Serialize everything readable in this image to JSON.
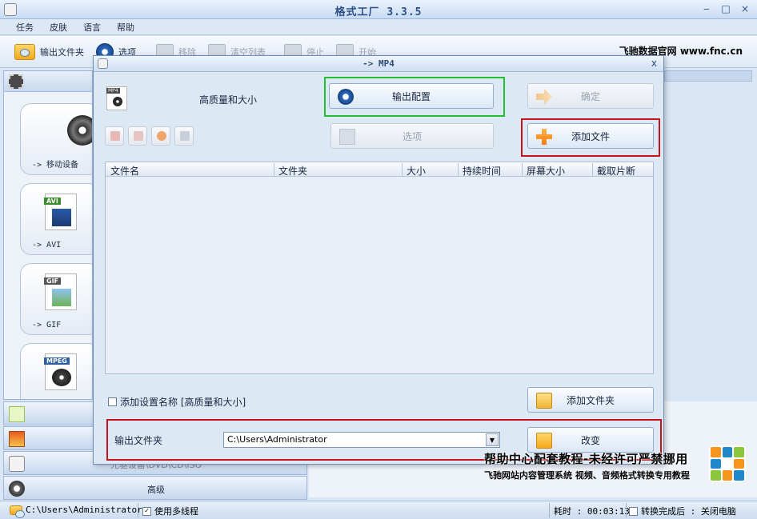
{
  "window": {
    "title": "格式工厂 3.3.5",
    "minimize": "‒",
    "maximize": "□",
    "close": "×"
  },
  "menu": [
    "任务",
    "皮肤",
    "语言",
    "帮助"
  ],
  "toolbar": {
    "output_folder": "输出文件夹",
    "options": "选项",
    "remove": "移除",
    "clear_list": "清空列表",
    "stop": "停止",
    "start": "开始"
  },
  "watermark_top": "飞驰数据官网 www.fnc.cn",
  "sidebar": {
    "tiles": [
      {
        "label": "-> 移动设备"
      },
      {
        "label": "-> AVI",
        "tag": "AVI"
      },
      {
        "label": "-> GIF",
        "tag": "GIF"
      },
      {
        "tag": "MPEG"
      }
    ],
    "behind_text": "光驱设备\\DVD\\CD\\ISO",
    "advanced": "高级"
  },
  "dialog": {
    "title": "-> MP4",
    "close": "x",
    "quality": "高质量和大小",
    "output_config_button": "输出配置",
    "ok_button": "确定",
    "options_button": "选项",
    "add_file_button": "添加文件",
    "columns": [
      "文件名",
      "文件夹",
      "大小",
      "持续时间",
      "屏幕大小",
      "截取片断"
    ],
    "add_setting_name": "添加设置名称 [高质量和大小]",
    "add_folder_button": "添加文件夹",
    "output_folder_label": "输出文件夹",
    "output_folder_value": "C:\\Users\\Administrator",
    "change_button": "改变"
  },
  "statusbar": {
    "path": "C:\\Users\\Administrator",
    "multithread": "使用多线程",
    "elapsed": "耗时 : 00:03:13",
    "after_done": "转换完成后 : 关闭电脑"
  },
  "watermark_bottom": {
    "line1": "帮助中心配套教程-未经许可严禁挪用",
    "line2": "飞驰网站内容管理系统 视频、音频格式转换专用教程"
  },
  "colors": {
    "highlight_red": "#c3131b",
    "highlight_green": "#22c033",
    "accent": "#2d6cc2"
  }
}
